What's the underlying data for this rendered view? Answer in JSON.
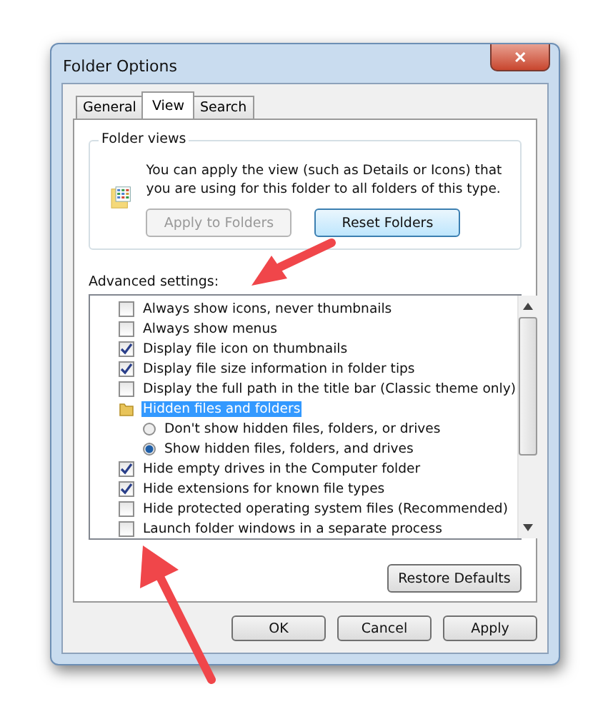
{
  "window": {
    "title": "Folder Options",
    "close": "✕"
  },
  "tabs": [
    {
      "label": "General",
      "selected": false
    },
    {
      "label": "View",
      "selected": true
    },
    {
      "label": "Search",
      "selected": false
    }
  ],
  "folder_views": {
    "title": "Folder views",
    "text": "You can apply the view (such as Details or Icons) that you are using for this folder to all folders of this type.",
    "buttons": [
      {
        "label": "Apply to Folders",
        "disabled": true
      },
      {
        "label": "Reset Folders",
        "disabled": false
      }
    ]
  },
  "advanced": {
    "label": "Advanced settings:",
    "items": [
      {
        "kind": "checkbox",
        "label": "Always show icons, never thumbnails",
        "checked": false
      },
      {
        "kind": "checkbox",
        "label": "Always show menus",
        "checked": false
      },
      {
        "kind": "checkbox",
        "label": "Display file icon on thumbnails",
        "checked": true
      },
      {
        "kind": "checkbox",
        "label": "Display file size information in folder tips",
        "checked": true
      },
      {
        "kind": "checkbox",
        "label": "Display the full path in the title bar (Classic theme only)",
        "checked": false
      },
      {
        "kind": "folder",
        "label": "Hidden files and folders",
        "selected": true,
        "children": [
          {
            "kind": "radio",
            "label": "Don't show hidden files, folders, or drives",
            "checked": false
          },
          {
            "kind": "radio",
            "label": "Show hidden files, folders, and drives",
            "checked": true
          }
        ]
      },
      {
        "kind": "checkbox",
        "label": "Hide empty drives in the Computer folder",
        "checked": true
      },
      {
        "kind": "checkbox",
        "label": "Hide extensions for known file types",
        "checked": true
      },
      {
        "kind": "checkbox",
        "label": "Hide protected operating system files (Recommended)",
        "checked": false
      },
      {
        "kind": "checkbox",
        "label": "Launch folder windows in a separate process",
        "checked": false
      }
    ]
  },
  "restore_button": "Restore Defaults",
  "buttons": [
    "OK",
    "Cancel",
    "Apply"
  ]
}
